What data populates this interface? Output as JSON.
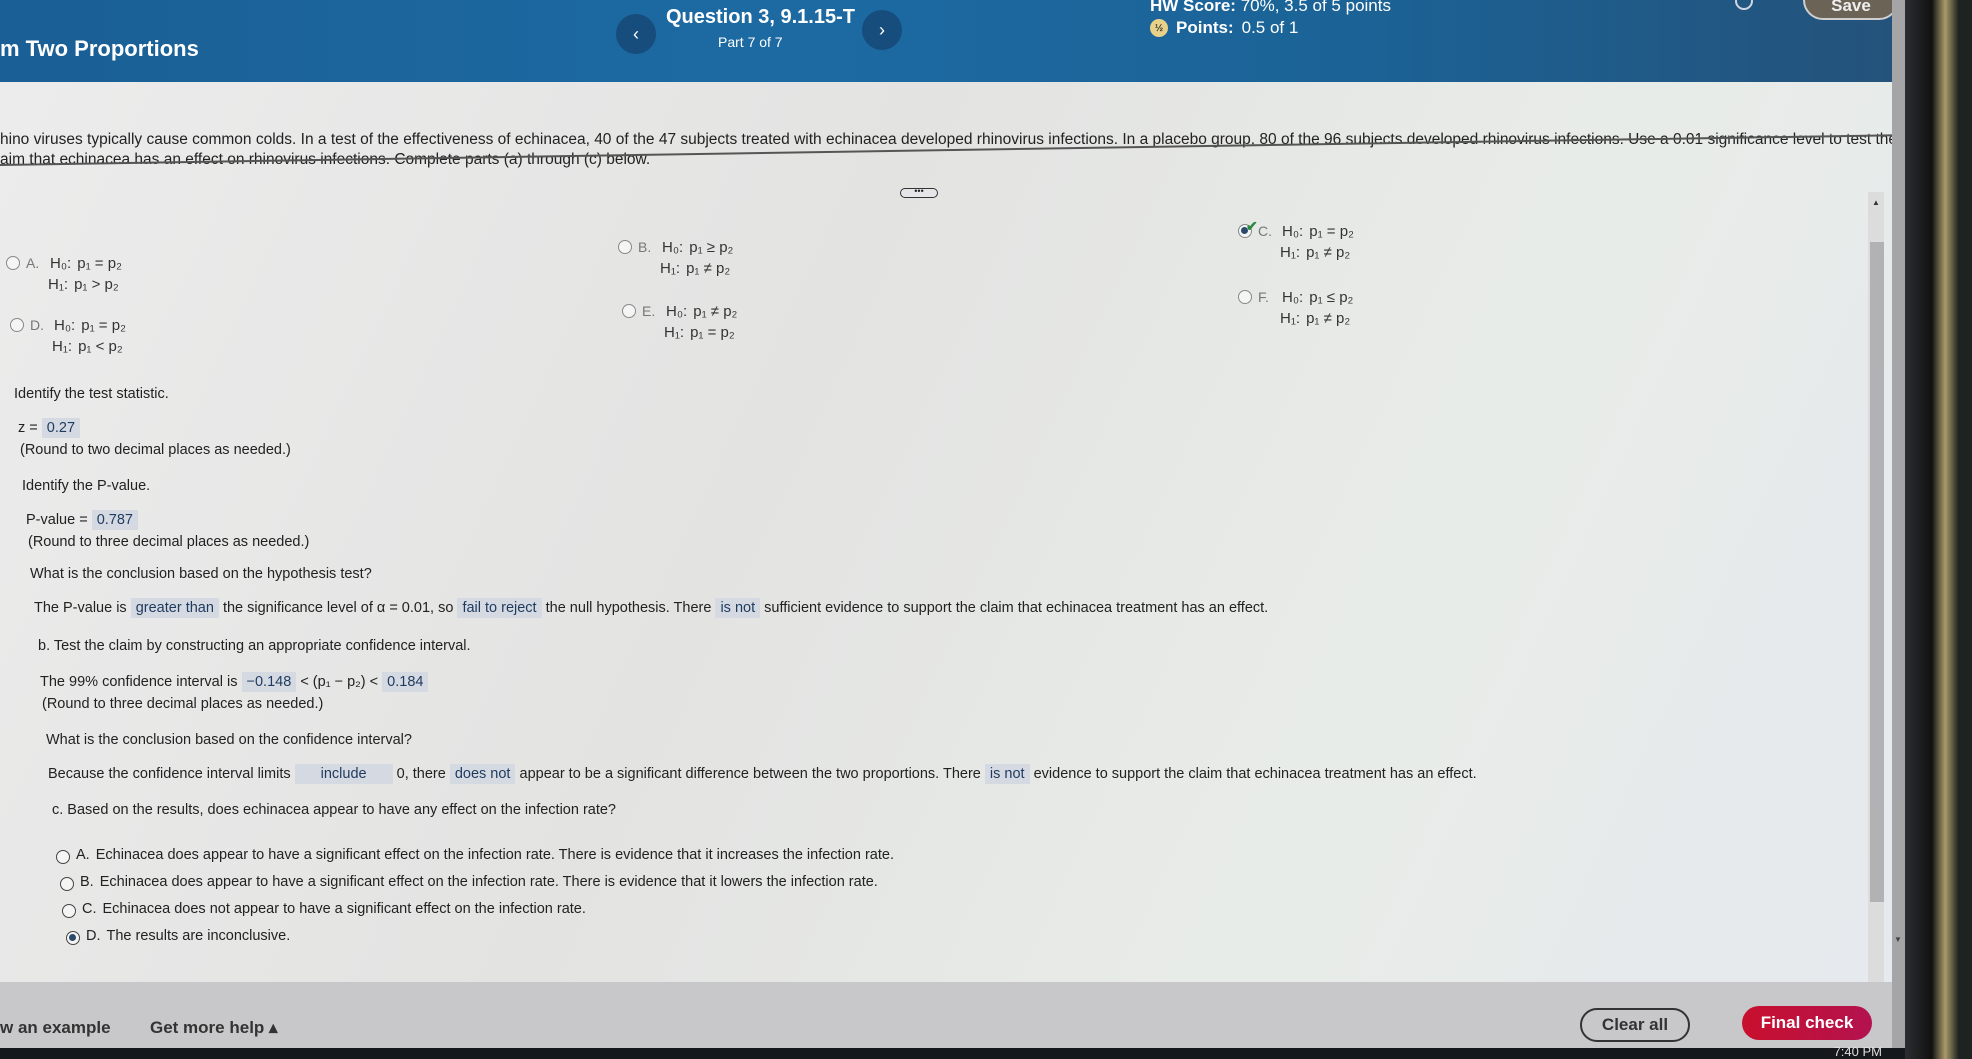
{
  "header": {
    "title": "m Two Proportions",
    "question_title": "Question 3, 9.1.15-T",
    "part": "Part 7 of 7",
    "prev_icon": "‹",
    "next_icon": "›",
    "hw_score_label": "HW Score:",
    "hw_score_value": "70%, 3.5 of 5 points",
    "points_label": "Points:",
    "points_value": "0.5 of 1",
    "partial_icon": "½",
    "save_label": "Save"
  },
  "problem": {
    "line1": "hino viruses typically cause common colds. In a test of the effectiveness of echinacea, 40 of the 47 subjects treated with echinacea developed rhinovirus infections. In a placebo group, 80 of the 96 subjects developed rhinovirus infections. Use a 0.01 significance level to test the",
    "line2": "aim that echinacea has an effect on rhinovirus infections. Complete parts (a) through (c) below.",
    "expander": "•••"
  },
  "hypotheses": [
    {
      "letter": "A.",
      "h0": "p₁ = p₂",
      "h1": "p₁ > p₂",
      "selected": false
    },
    {
      "letter": "B.",
      "h0": "p₁ ≥ p₂",
      "h1": "p₁ ≠ p₂",
      "selected": false
    },
    {
      "letter": "C.",
      "h0": "p₁ = p₂",
      "h1": "p₁ ≠ p₂",
      "selected": true,
      "correct": true
    },
    {
      "letter": "D.",
      "h0": "p₁ = p₂",
      "h1": "p₁ < p₂",
      "selected": false
    },
    {
      "letter": "E.",
      "h0": "p₁ ≠ p₂",
      "h1": "p₁ = p₂",
      "selected": false
    },
    {
      "letter": "F.",
      "h0": "p₁ ≤ p₂",
      "h1": "p₁ ≠ p₂",
      "selected": false
    }
  ],
  "h0_label": "H₀:",
  "h1_label": "H₁:",
  "test_stat": {
    "prompt": "Identify the test statistic.",
    "label": "z =",
    "value": "0.27",
    "note": "(Round to two decimal places as needed.)"
  },
  "p_value": {
    "prompt": "Identify the P-value.",
    "label": "P-value =",
    "value": "0.787",
    "note": "(Round to three decimal places as needed.)"
  },
  "conclusion_test": {
    "prompt": "What is the conclusion based on the hypothesis test?",
    "t1": "The P-value is",
    "a1": "greater than",
    "t2": "the significance level of α = 0.01, so",
    "a2": "fail to reject",
    "t3": "the null hypothesis. There",
    "a3": "is not",
    "t4": "sufficient evidence to support the claim that echinacea treatment has an effect."
  },
  "part_b": {
    "prompt": "b. Test the claim by constructing an appropriate confidence interval.",
    "t1": "The 99% confidence interval is",
    "lower": "−0.148",
    "mid": "< (p₁ − p₂) <",
    "upper": "0.184",
    "note": "(Round to three decimal places as needed.)"
  },
  "conclusion_ci": {
    "prompt": "What is the conclusion based on the confidence interval?",
    "t1": "Because the confidence interval limits",
    "a1": "include",
    "t2": "0, there",
    "a2": "does not",
    "t3": "appear to be a significant difference between the two proportions. There",
    "a3": "is not",
    "t4": "evidence to support the claim that echinacea treatment has an effect."
  },
  "part_c": {
    "prompt": "c. Based on the results, does echinacea appear to have any effect on the infection rate?",
    "options": [
      {
        "letter": "A.",
        "text": "Echinacea does appear to have a significant effect on the infection rate. There is evidence that it increases the infection rate.",
        "selected": false
      },
      {
        "letter": "B.",
        "text": "Echinacea does appear to have a significant effect on the infection rate. There is evidence that it lowers the infection rate.",
        "selected": false
      },
      {
        "letter": "C.",
        "text": "Echinacea does not appear to have a significant effect on the infection rate.",
        "selected": false
      },
      {
        "letter": "D.",
        "text": "The results are inconclusive.",
        "selected": true
      }
    ]
  },
  "footer": {
    "example_link": "w an example",
    "help_link": "Get more help ▴",
    "clear_label": "Clear all",
    "final_label": "Final check"
  },
  "system": {
    "clock": "7:40 PM"
  }
}
